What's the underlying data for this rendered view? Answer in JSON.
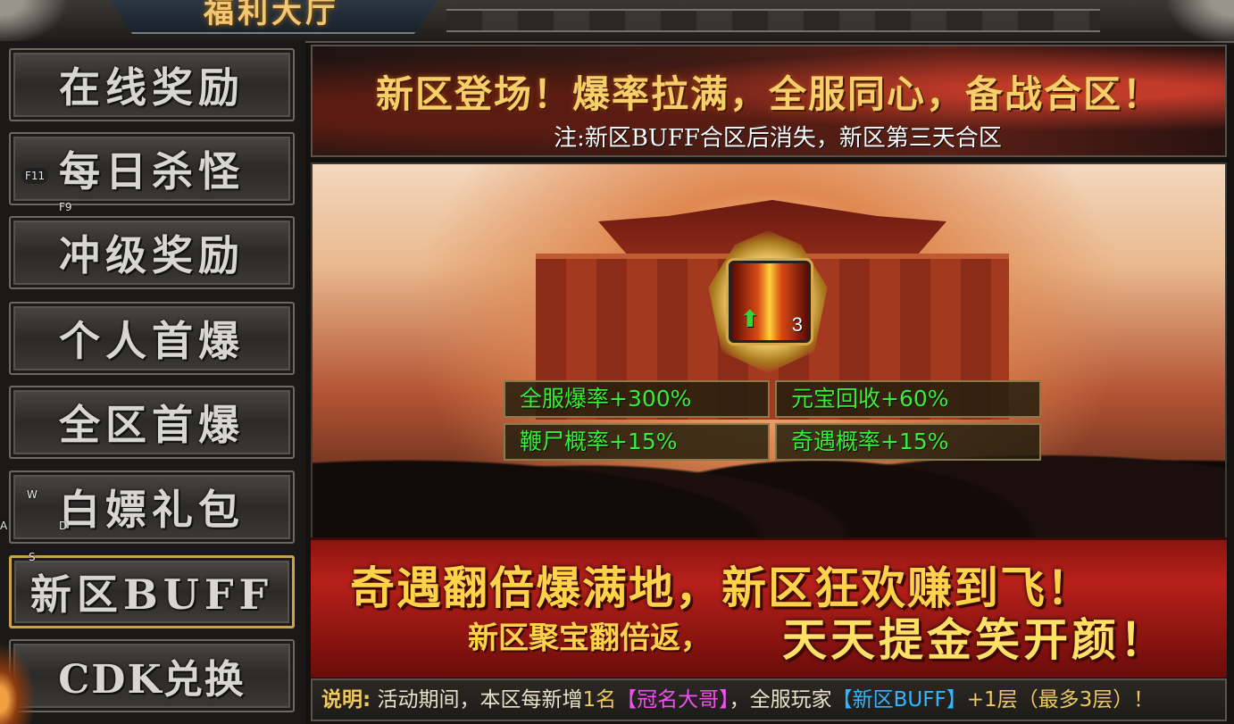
{
  "window": {
    "title": "福利大厅"
  },
  "sidebar": {
    "items": [
      {
        "label": "在线奖励"
      },
      {
        "label": "每日杀怪"
      },
      {
        "label": "冲级奖励"
      },
      {
        "label": "个人首爆"
      },
      {
        "label": "全区首爆"
      },
      {
        "label": "白嫖礼包"
      },
      {
        "label": "新区BUFF",
        "active": true
      },
      {
        "label": "CDK兑换"
      }
    ],
    "active_index": 6
  },
  "key_hints": {
    "f11": "F11",
    "f9": "F9",
    "w": "W",
    "a": "A",
    "d": "D",
    "s": "S"
  },
  "banner": {
    "headline": "新区登场！爆率拉满，全服同心，备战合区！",
    "note": "注:新区BUFF合区后消失，新区第三天合区"
  },
  "buff": {
    "icon": "fire-pillar-up-arrow-icon",
    "level": "3"
  },
  "stats": [
    {
      "label": "全服爆率+300%"
    },
    {
      "label": "元宝回收+60%"
    },
    {
      "label": "鞭尸概率+15%"
    },
    {
      "label": "奇遇概率+15%"
    }
  ],
  "promo": {
    "line1": "奇遇翻倍爆满地，新区狂欢赚到飞！",
    "line2": "新区聚宝翻倍返，",
    "line3": "天天提金笑开颜！"
  },
  "footer": {
    "label": "说明:",
    "text1": " 活动期间，本区每新增",
    "count": "1名",
    "title_name": "【冠名大哥】",
    "text2": "，全服玩家",
    "buff_name": "【新区BUFF】",
    "text3": "+1层（最多3层）！"
  },
  "colors": {
    "gold_text": "#f6cf6a",
    "stat_green": "#36f036",
    "active_border": "#c9a24a",
    "promo_red": "#b8201a",
    "footer_pink": "#f050f0",
    "footer_blue": "#30b8ff"
  }
}
